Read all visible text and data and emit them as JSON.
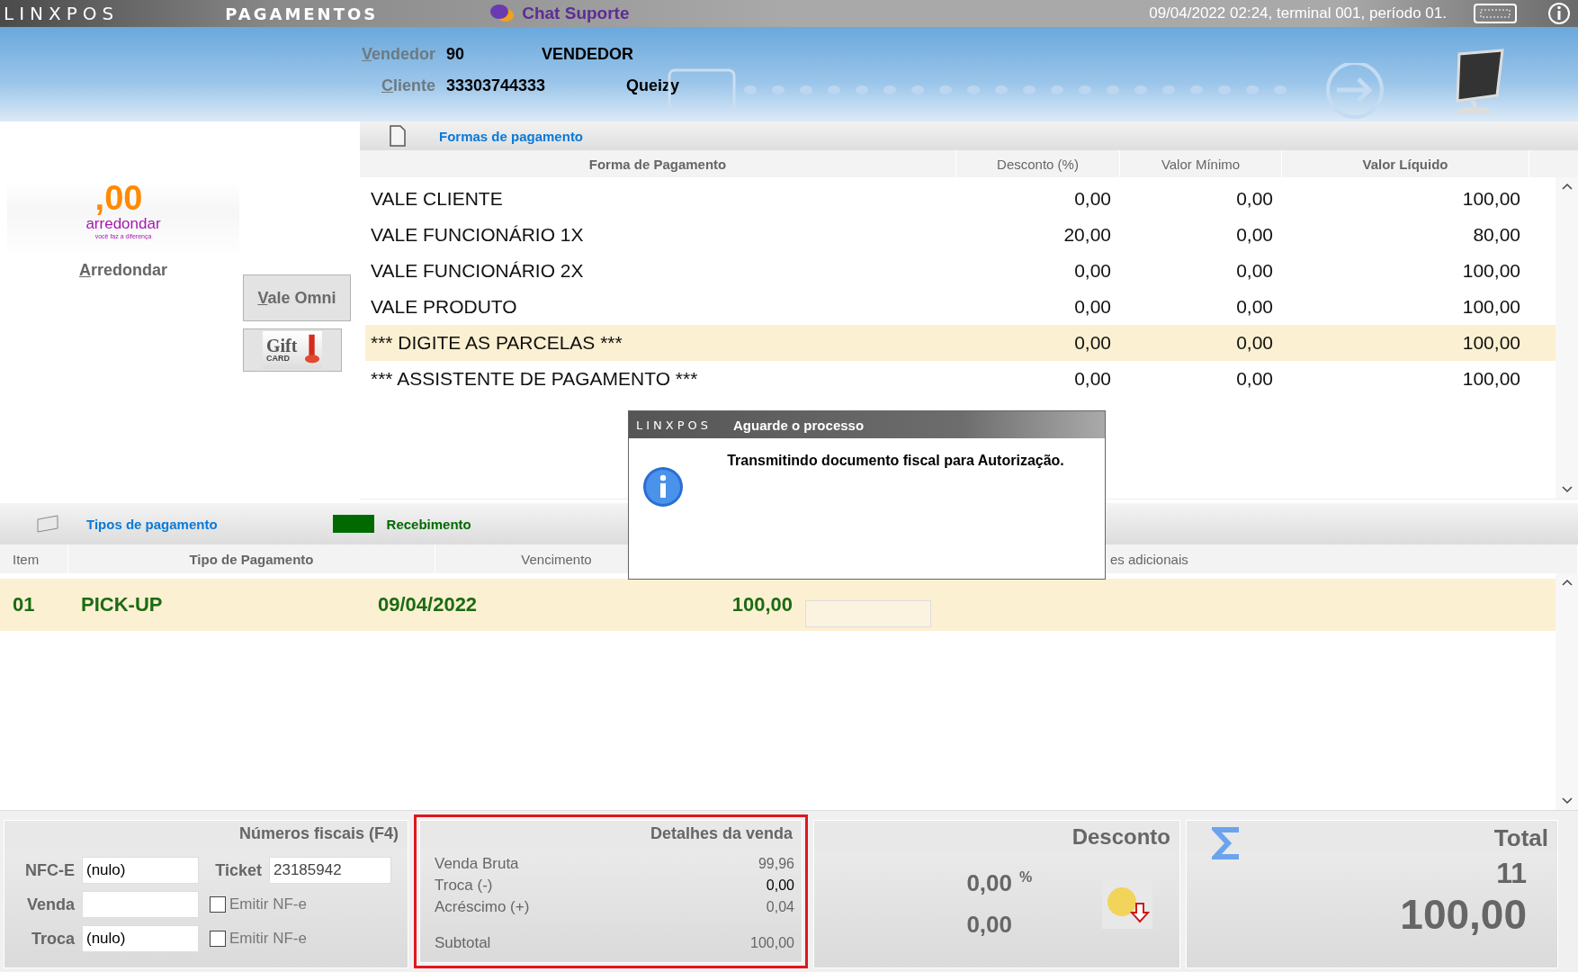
{
  "top_bar": {
    "logo": "LINXPOS",
    "title": "PAGAMENTOS",
    "chat": "Chat Suporte",
    "status": "09/04/2022 02:24, terminal 001, período 01."
  },
  "header": {
    "vendedor_label": "Vendedor",
    "vendedor_code": "90",
    "vendedor_name": "VENDEDOR",
    "cliente_label": "Cliente",
    "cliente_code": "33303744333",
    "cliente_name": "Queizy"
  },
  "left_panel": {
    "logo_amount": ",00",
    "logo_name": "arredondar",
    "logo_tagline": "você faz a diferença",
    "arredondar_label": "Arredondar",
    "vale_omni_button": "Vale Omni",
    "gift_text": "Gift",
    "gift_sub": "CARD"
  },
  "payment_forms": {
    "title": "Formas de pagamento",
    "columns": [
      "Forma de Pagamento",
      "Desconto (%)",
      "Valor Mínimo",
      "Valor Líquido"
    ],
    "rows": [
      {
        "name": "VALE CLIENTE",
        "discount": "0,00",
        "minimum": "0,00",
        "net": "100,00",
        "selected": false
      },
      {
        "name": "VALE FUNCIONÁRIO 1X",
        "discount": "20,00",
        "minimum": "0,00",
        "net": "80,00",
        "selected": false
      },
      {
        "name": "VALE FUNCIONÁRIO 2X",
        "discount": "0,00",
        "minimum": "0,00",
        "net": "100,00",
        "selected": false
      },
      {
        "name": "VALE PRODUTO",
        "discount": "0,00",
        "minimum": "0,00",
        "net": "100,00",
        "selected": false
      },
      {
        "name": "*** DIGITE AS PARCELAS ***",
        "discount": "0,00",
        "minimum": "0,00",
        "net": "100,00",
        "selected": true
      },
      {
        "name": "*** ASSISTENTE DE PAGAMENTO ***",
        "discount": "0,00",
        "minimum": "0,00",
        "net": "100,00",
        "selected": false
      }
    ]
  },
  "payment_types": {
    "title": "Tipos de pagamento",
    "legend": "Recebimento",
    "columns": [
      "Item",
      "Tipo de Pagamento",
      "Vencimento",
      "es adicionais"
    ],
    "rows": [
      {
        "item": "01",
        "type": "PICK-UP",
        "due": "09/04/2022",
        "value": "100,00",
        "selected": true
      }
    ]
  },
  "fiscal": {
    "title": "Números fiscais (F4)",
    "nfce_label": "NFC-E",
    "nfce_value": "(nulo)",
    "ticket_label": "Ticket",
    "ticket_value": "23185942",
    "venda_label": "Venda",
    "troca_label": "Troca",
    "troca_value": "(nulo)",
    "emit": [
      {
        "label": "Emitir NF-e",
        "checked": false
      },
      {
        "label": "Emitir NF-e",
        "checked": false
      }
    ]
  },
  "details": {
    "title": "Detalhes da venda",
    "highlighted": true,
    "lines": [
      {
        "label": "Venda Bruta",
        "value": "99,96",
        "kind": "line",
        "strong": false
      },
      {
        "label": "Troca (-)",
        "value": "0,00",
        "kind": "line",
        "strong": true
      },
      {
        "label": "Acréscimo (+)",
        "value": "0,04",
        "kind": "line",
        "strong": false
      },
      {
        "label": "Subtotal",
        "value": "100,00",
        "kind": "subtotal",
        "strong": false
      }
    ]
  },
  "discount": {
    "title": "Desconto",
    "percent": "0,00",
    "percent_sign": "%",
    "amount": "0,00"
  },
  "total": {
    "title": "Total",
    "count": "11",
    "amount": "100,00"
  },
  "dialog": {
    "logo": "LINXPOS",
    "title": "Aguarde o processo",
    "message": "Transmitindo documento fiscal para Autorização."
  }
}
